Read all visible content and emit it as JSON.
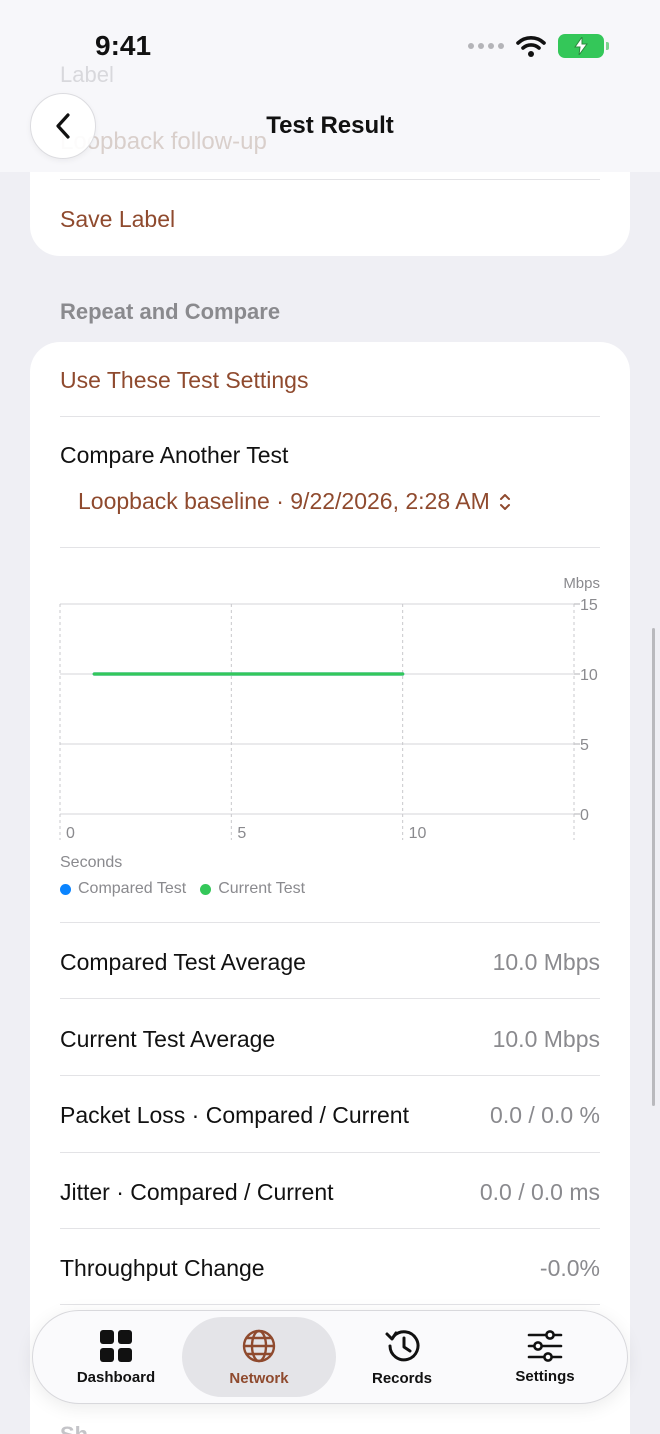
{
  "status": {
    "time": "9:41"
  },
  "nav": {
    "title": "Test Result"
  },
  "label_card": {
    "ghost_label": "Label",
    "ghost_value": "Loopback follow-up",
    "save_label": "Save Label"
  },
  "section": {
    "header": "Repeat and Compare"
  },
  "compare": {
    "use_settings": "Use These Test Settings",
    "title": "Compare Another Test",
    "selected": "Loopback baseline · 9/22/2026, 2:28 AM"
  },
  "chart_data": {
    "type": "line",
    "ylabel": "Mbps",
    "xlabel": "Seconds",
    "ylim": [
      0,
      15
    ],
    "xlim": [
      0,
      15
    ],
    "y_ticks": [
      "0",
      "5",
      "10",
      "15"
    ],
    "x_ticks": [
      "0",
      "5",
      "10"
    ],
    "series": [
      {
        "name": "Compared Test",
        "color": "#0a84ff",
        "x": [
          1,
          10
        ],
        "y": [
          10,
          10
        ]
      },
      {
        "name": "Current Test",
        "color": "#34c759",
        "x": [
          1,
          10
        ],
        "y": [
          10,
          10
        ]
      }
    ],
    "legend": "bottom-left",
    "grid": true
  },
  "stats": [
    {
      "label": "Compared Test Average",
      "value": "10.0 Mbps"
    },
    {
      "label": "Current Test Average",
      "value": "10.0 Mbps"
    },
    {
      "label": "Packet Loss · Compared / Current",
      "value": "0.0 / 0.0 %"
    },
    {
      "label": "Jitter · Compared / Current",
      "value": "0.0 / 0.0 ms"
    },
    {
      "label": "Throughput Change",
      "value": "-0.0%"
    }
  ],
  "tabs": [
    {
      "label": "Dashboard",
      "icon": "grid-icon"
    },
    {
      "label": "Network",
      "icon": "globe-icon"
    },
    {
      "label": "Records",
      "icon": "history-icon"
    },
    {
      "label": "Settings",
      "icon": "sliders-icon"
    }
  ],
  "ghost_bottom": "Sh",
  "colors": {
    "accent": "#8f4a2e",
    "current": "#34c759",
    "compared": "#0a84ff"
  }
}
